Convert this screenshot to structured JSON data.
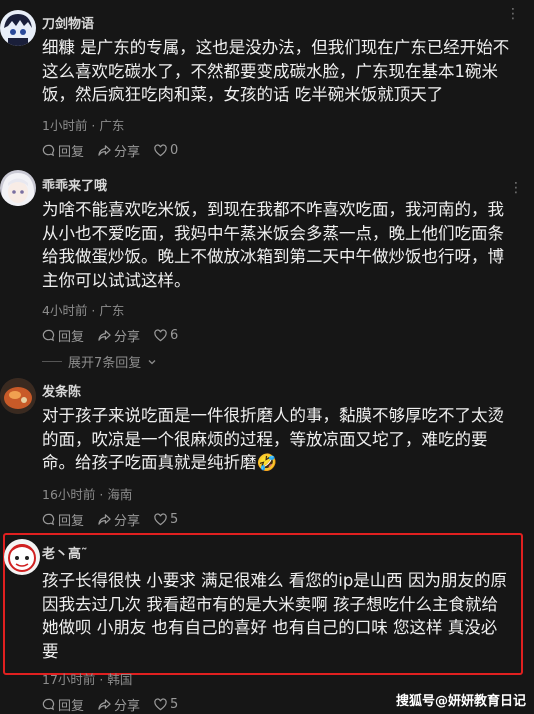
{
  "comments": [
    {
      "username": "刀剑物语",
      "text": "细糠 是广东的专属，这也是没办法，但我们现在广东已经开始不\n这么喜欢吃碳水了，不然都要变成碳水脸，广东现在基本1碗米\n饭，然后疯狂吃肉和菜，女孩的话 吃半碗米饭就顶天了",
      "time": "1小时前",
      "location": "广东",
      "reply_label": "回复",
      "share_label": "分享",
      "likes": "0"
    },
    {
      "username": "乖乖来了哦",
      "text": "为啥不能喜欢吃米饭，到现在我都不咋喜欢吃面，我河南的，我\n从小也不爱吃面，我妈中午蒸米饭会多蒸一点，晚上他们吃面条\n给我做蛋炒饭。晚上不做放冰箱到第二天中午做炒饭也行呀，博\n主你可以试试这样。",
      "time": "4小时前",
      "location": "广东",
      "reply_label": "回复",
      "share_label": "分享",
      "likes": "6",
      "expand_replies": "展开7条回复"
    },
    {
      "username": "发条陈",
      "text": "对于孩子来说吃面是一件很折磨人的事，黏膜不够厚吃不了太烫\n的面，吹凉是一个很麻烦的过程，等放凉面又坨了，难吃的要\n命。给孩子吃面真就是纯折磨🤣",
      "time": "16小时前",
      "location": "海南",
      "reply_label": "回复",
      "share_label": "分享",
      "likes": "5"
    },
    {
      "username": "老丶高˜",
      "text": "孩子长得很快 小要求 满足很难么 看您的ip是山西 因为朋友的原\n因我去过几次 我看超市有的是大米卖啊 孩子想吃什么主食就给\n她做呗 小朋友 也有自己的喜好 也有自己的口味 您这样 真没必\n要",
      "time": "17小时前",
      "location": "韩国",
      "reply_label": "回复",
      "share_label": "分享",
      "likes": "5"
    }
  ],
  "meta_separator": " · ",
  "watermark": "搜狐号@妍妍教育日记",
  "accent_color": "#e02020"
}
